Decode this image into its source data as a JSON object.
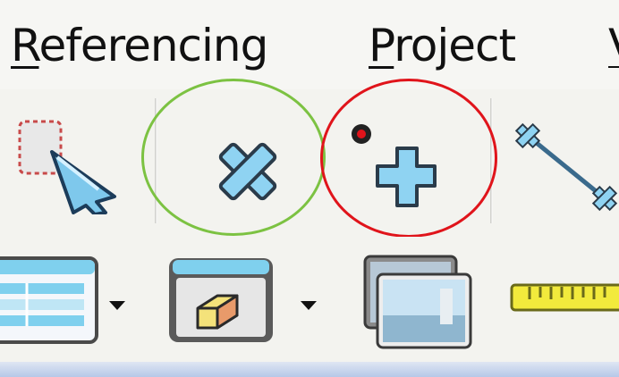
{
  "menu": {
    "referencing": {
      "mnemonic": "R",
      "rest": "eferencing"
    },
    "project": {
      "mnemonic": "P",
      "rest": "roject"
    },
    "next": {
      "mnemonic": "V",
      "rest": ""
    }
  },
  "highlights": {
    "green_circle_color": "#7cc242",
    "red_circle_color": "#e0141b"
  },
  "icons": {
    "select_features": "select-pointer-icon",
    "delete_point": "delete-point-icon",
    "add_point": "add-point-icon",
    "move_gcp": "move-point-line-icon",
    "open_table": "attribute-table-icon",
    "select_3d": "box-select-icon",
    "raster_image": "raster-image-icon",
    "measure": "measure-ruler-icon"
  }
}
